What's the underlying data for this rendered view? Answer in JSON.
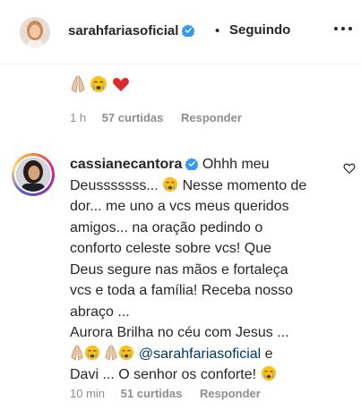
{
  "header": {
    "username": "sarahfariasoficial",
    "separator": "•",
    "follow_label": "Seguindo"
  },
  "top_comment": {
    "emojis": [
      "folded-hands-icon",
      "crying-face-icon",
      "red-heart-icon"
    ],
    "time": "1 h",
    "likes": "57 curtidas",
    "reply": "Responder"
  },
  "comment": {
    "username": "cassianecantora",
    "lines": [
      "Ohhh meu",
      "Deusssssss...",
      "Nesse momento de",
      "dor... me uno a vcs meus queridos",
      "amigos... na oração pedindo o",
      "conforto celeste sobre vcs! Que",
      "Deus segure nas mãos e fortaleça",
      "vcs e toda a família! Receba nosso",
      "abraço ...",
      "Aurora Brilha no céu com Jesus ...",
      "@sarahfariasoficial",
      "e",
      "Davi ... O senhor os conforte!"
    ],
    "time": "10 min",
    "likes": "51 curtidas",
    "reply": "Responder"
  },
  "colors": {
    "text": "#262626",
    "meta": "#8e8e8e",
    "verified": "#3897f0",
    "mention": "#00376b",
    "heart": "#ed4956"
  }
}
